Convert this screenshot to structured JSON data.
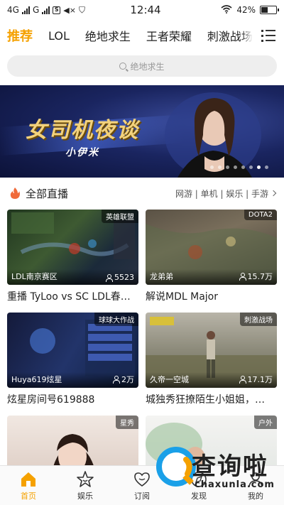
{
  "status_bar": {
    "network_left": "4G",
    "network_right": "G",
    "time": "12:44",
    "battery": "42%"
  },
  "tabs": [
    "推荐",
    "LOL",
    "绝地求生",
    "王者荣耀",
    "刺激战场"
  ],
  "active_tab": "推荐",
  "search": {
    "placeholder": "绝地求生"
  },
  "banner": {
    "title": "女司机夜谈",
    "subtitle": "小伊米",
    "dots": 8,
    "active_dot": 7
  },
  "section": {
    "title": "全部直播",
    "links": "网游 | 单机 | 娱乐 | 手游"
  },
  "streams": [
    {
      "tag": "英雄联盟",
      "streamer": "LDL南京赛区",
      "viewers": "5523",
      "title": "重播 TyLoo vs SC LDL春…"
    },
    {
      "tag": "DOTA2",
      "streamer": "龙弟弟",
      "viewers": "15.7万",
      "title": "解说MDL Major"
    },
    {
      "tag": "球球大作战",
      "streamer": "Huya619炫星",
      "viewers": "2万",
      "title": "炫星房间号619888"
    },
    {
      "tag": "刺激战场",
      "streamer": "久帝一空城",
      "viewers": "17.1万",
      "title": "城独秀狂撩陌生小姐姐，…"
    },
    {
      "tag": "星秀",
      "streamer": "",
      "viewers": "",
      "title": ""
    },
    {
      "tag": "户外",
      "streamer": "",
      "viewers": "",
      "title": ""
    }
  ],
  "bottom_nav": [
    {
      "label": "首页",
      "icon": "home-icon"
    },
    {
      "label": "娱乐",
      "icon": "star-icon"
    },
    {
      "label": "订阅",
      "icon": "heart-icon"
    },
    {
      "label": "发现",
      "icon": "discover-icon"
    },
    {
      "label": "我的",
      "icon": "profile-icon"
    }
  ],
  "watermark": {
    "main": "查询啦",
    "sub": "chaxunla.com"
  },
  "colors": {
    "accent": "#f5a100"
  }
}
